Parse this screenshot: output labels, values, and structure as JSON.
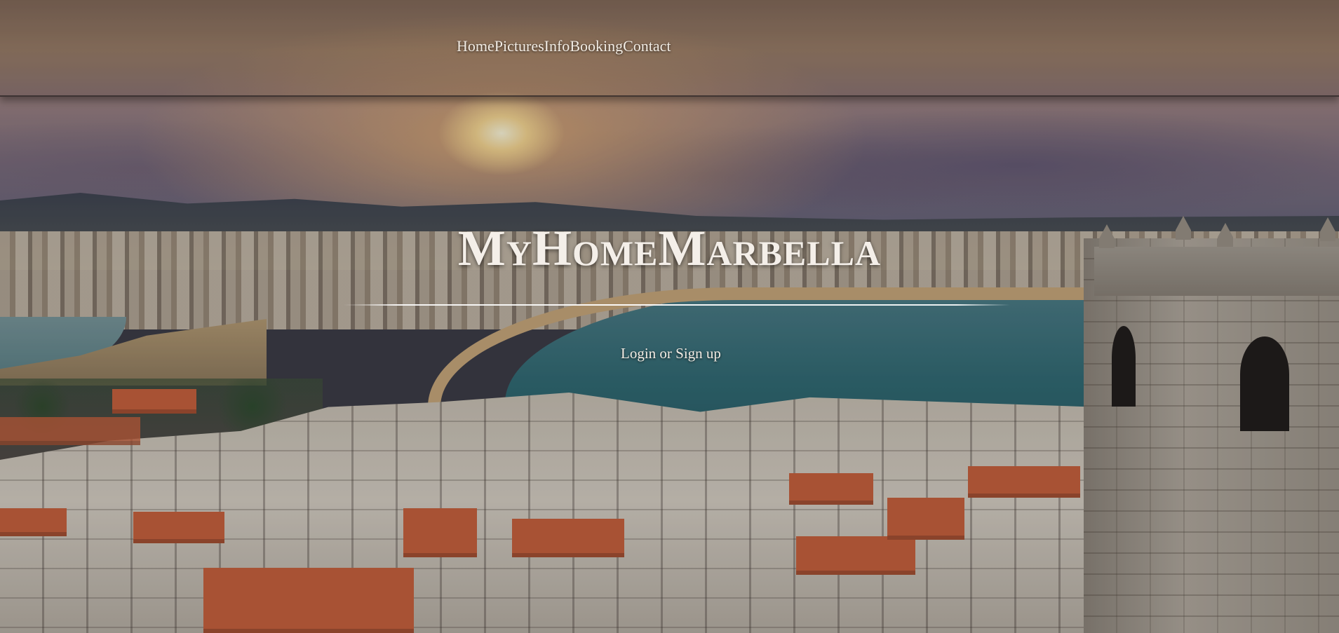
{
  "nav": {
    "items": [
      {
        "label": "Home"
      },
      {
        "label": "Pictures"
      },
      {
        "label": "Info"
      },
      {
        "label": "Booking"
      },
      {
        "label": "Contact"
      }
    ]
  },
  "hero": {
    "brand": "MyHomeMarbella",
    "login_label": "Login or Sign up",
    "background_image": "coastal-town-sunset-photo"
  },
  "colors": {
    "nav_text": "#f2ece4",
    "brand_text": "#f4efe9"
  }
}
